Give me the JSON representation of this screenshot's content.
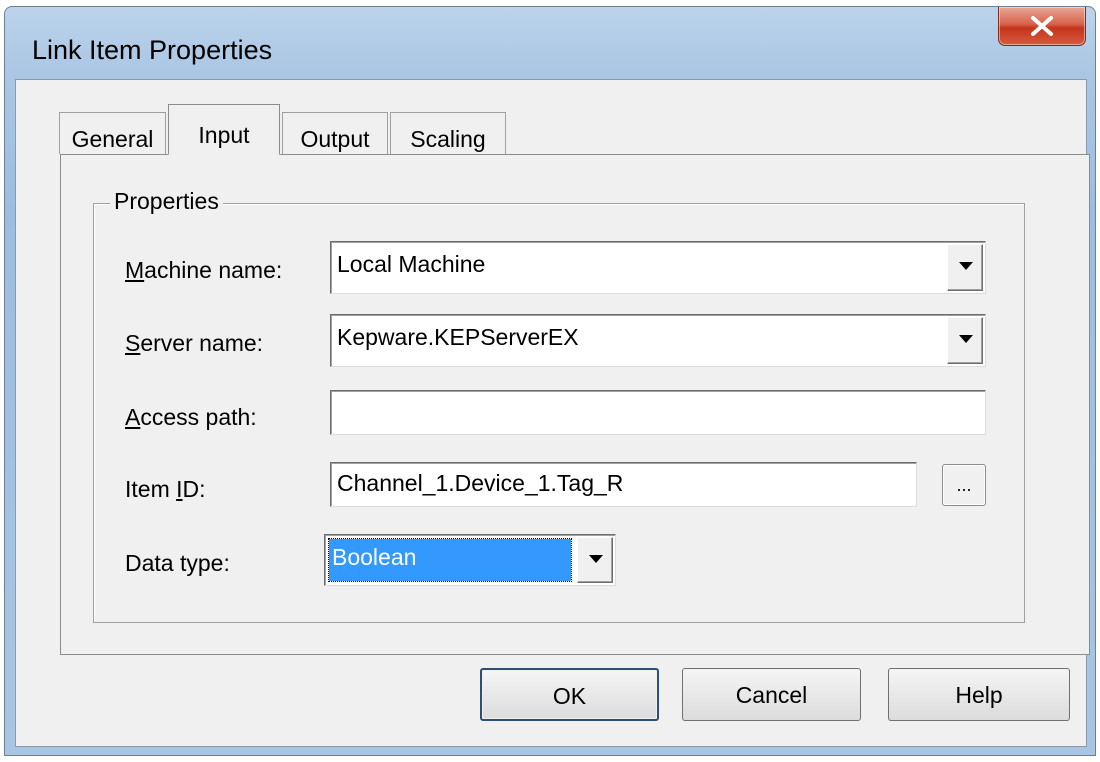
{
  "window": {
    "title": "Link Item Properties"
  },
  "tabs": [
    {
      "label": "General"
    },
    {
      "label": "Input"
    },
    {
      "label": "Output"
    },
    {
      "label": "Scaling"
    }
  ],
  "active_tab": "Input",
  "properties": {
    "group_title": "Properties",
    "machine_name": {
      "label_first": "M",
      "label_rest": "achine name:",
      "value": "Local Machine"
    },
    "server_name": {
      "label_first": "S",
      "label_rest": "erver name:",
      "value": "Kepware.KEPServerEX"
    },
    "access_path": {
      "label_first": "A",
      "label_rest": "ccess path:",
      "value": ""
    },
    "item_id": {
      "label_pre": "Item ",
      "label_first": "I",
      "label_rest": "D:",
      "value": "Channel_1.Device_1.Tag_R",
      "browse_label": "..."
    },
    "data_type": {
      "label": "Data type:",
      "value": "Boolean"
    }
  },
  "buttons": {
    "ok": "OK",
    "cancel": "Cancel",
    "help": "Help"
  },
  "colors": {
    "selection": "#3399ff",
    "close_button": "#c4351c",
    "dialog_face": "#f0f0f0"
  }
}
